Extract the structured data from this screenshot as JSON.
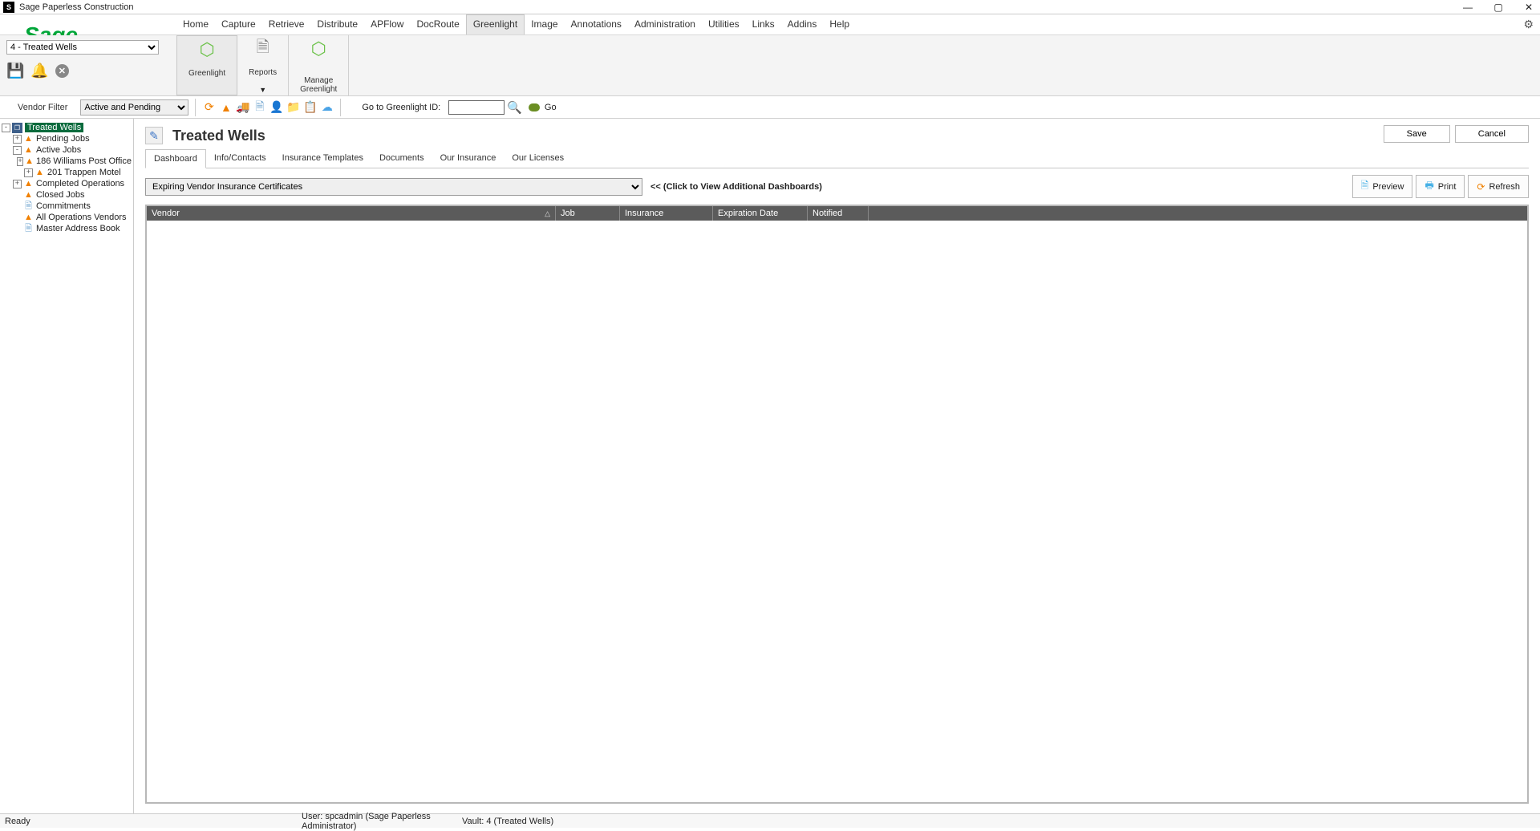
{
  "app": {
    "title": "Sage Paperless Construction"
  },
  "window": {
    "min": "—",
    "max": "▢",
    "close": "✕"
  },
  "logo": "Sage",
  "menu": [
    "Home",
    "Capture",
    "Retrieve",
    "Distribute",
    "APFlow",
    "DocRoute",
    "Greenlight",
    "Image",
    "Annotations",
    "Administration",
    "Utilities",
    "Links",
    "Addins",
    "Help"
  ],
  "menu_active_index": 6,
  "vault_selector": "4 - Treated Wells",
  "ribbon": {
    "greenlight": "Greenlight",
    "reports": "Reports",
    "manage1": "Manage",
    "manage2": "Greenlight"
  },
  "vendor_filter_label": "Vendor Filter",
  "vendor_filter_value": "Active and Pending",
  "goto_label": "Go to Greenlight ID:",
  "go_text": "Go",
  "tree": {
    "root": "Treated Wells",
    "pending": "Pending Jobs",
    "active": "Active Jobs",
    "job1": "186  Williams Post Office",
    "job2": "201  Trappen Motel",
    "completed": "Completed Operations",
    "closed": "Closed Jobs",
    "commit": "Commitments",
    "allops": "All Operations Vendors",
    "master": "Master Address Book"
  },
  "page": {
    "title": "Treated Wells"
  },
  "buttons": {
    "save": "Save",
    "cancel": "Cancel"
  },
  "subtabs": [
    "Dashboard",
    "Info/Contacts",
    "Insurance Templates",
    "Documents",
    "Our Insurance",
    "Our Licenses"
  ],
  "subtab_active_index": 0,
  "dash_select": "Expiring Vendor Insurance Certificates",
  "dash_more_prefix": "<<  ",
  "dash_more": "(Click to View Additional Dashboards)",
  "action_buttons": {
    "preview": "Preview",
    "print": "Print",
    "refresh": "Refresh"
  },
  "grid_headers": {
    "vendor": "Vendor",
    "job": "Job",
    "insurance": "Insurance",
    "expiration": "Expiration Date",
    "notified": "Notified"
  },
  "status": {
    "ready": "Ready",
    "user": "User: spcadmin (Sage Paperless Administrator)",
    "vault": "Vault: 4 (Treated Wells)"
  }
}
